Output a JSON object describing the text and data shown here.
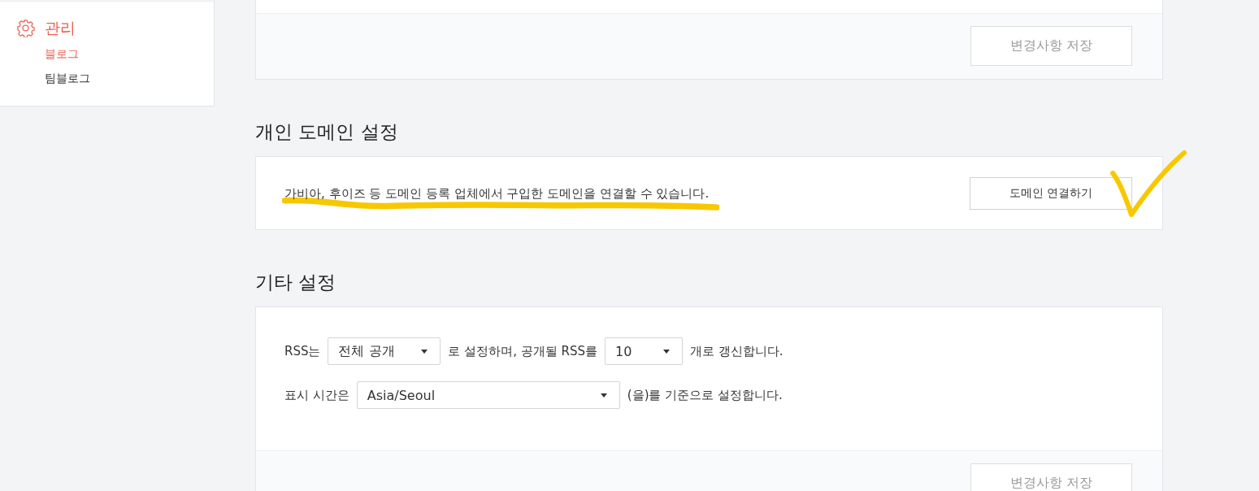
{
  "sidebar": {
    "group": {
      "label": "관리",
      "active": true
    },
    "items": [
      {
        "label": "블로그",
        "selected": true
      },
      {
        "label": "팀블로그",
        "selected": false
      }
    ]
  },
  "top_card": {
    "save_button": {
      "label": "변경사항 저장",
      "disabled": true
    }
  },
  "domain_section": {
    "title": "개인 도메인 설정",
    "description": "가비아, 후이즈 등 도메인 등록 업체에서 구입한 도메인을 연결할 수 있습니다.",
    "highlighted": true,
    "check_mark": true,
    "button": {
      "label": "도메인 연결하기",
      "disabled": false
    }
  },
  "other_section": {
    "title": "기타 설정",
    "rows": [
      {
        "parts": [
          {
            "kind": "text",
            "text": "RSS는"
          },
          {
            "kind": "select",
            "value": "전체 공개"
          },
          {
            "kind": "text",
            "text": "로 설정하며, 공개될 RSS를"
          },
          {
            "kind": "select",
            "value": "10"
          },
          {
            "kind": "text",
            "text": "개로 갱신합니다."
          }
        ]
      },
      {
        "parts": [
          {
            "kind": "text",
            "text": "표시 시간은"
          },
          {
            "kind": "select",
            "value": "Asia/Seoul"
          },
          {
            "kind": "text",
            "text": "(을)를 기준으로 설정합니다."
          }
        ]
      }
    ],
    "save_button": {
      "label": "변경사항 저장",
      "disabled": true
    }
  }
}
